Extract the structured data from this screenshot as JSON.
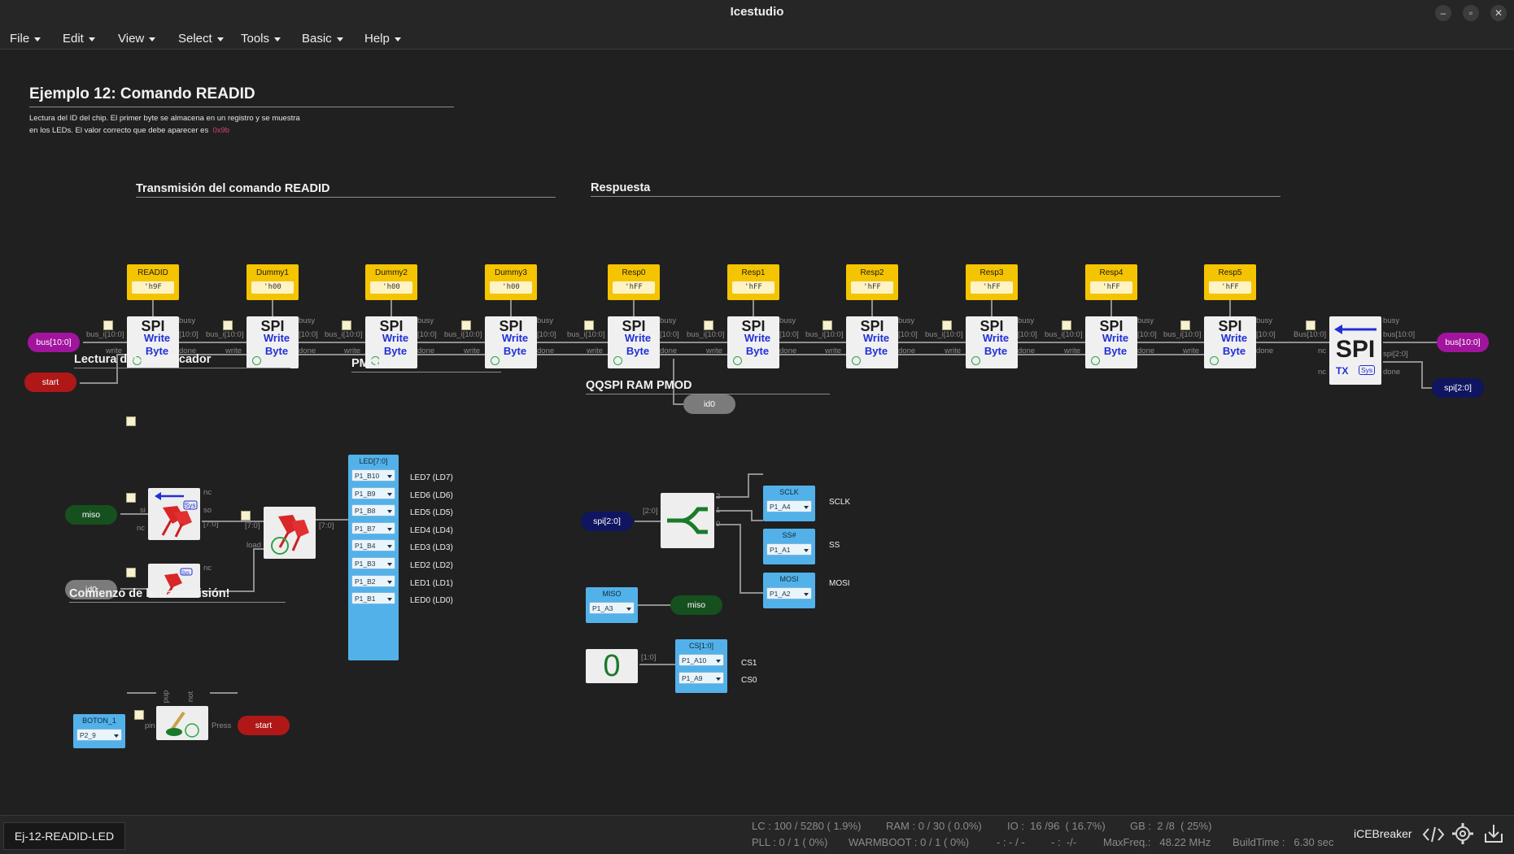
{
  "window": {
    "title": "Icestudio"
  },
  "menu": [
    "File",
    "Edit",
    "View",
    "Select",
    "Tools",
    "Basic",
    "Help"
  ],
  "canvas": {
    "title": "Ejemplo 12: Comando READID",
    "description_1": "Lectura del ID del chip. El primer byte se almacena en un registro y se muestra",
    "description_2": "en los LEDs. El valor correcto que debe aparecer es",
    "description_value": "0x9b",
    "section_tx": "Transmisión del comando READID",
    "section_resp": "Respuesta",
    "section_read": "Lectura del identificador",
    "section_pmod": "PMOD 8LD",
    "section_qqspi": "QQSPI RAM PMOD",
    "section_start": "Comienzo de la transmisión!",
    "constants": [
      {
        "name": "READID",
        "value": "'h9F"
      },
      {
        "name": "Dummy1",
        "value": "'h00"
      },
      {
        "name": "Dummy2",
        "value": "'h00"
      },
      {
        "name": "Dummy3",
        "value": "'h00"
      },
      {
        "name": "Resp0",
        "value": "'hFF"
      },
      {
        "name": "Resp1",
        "value": "'hFF"
      },
      {
        "name": "Resp2",
        "value": "'hFF"
      },
      {
        "name": "Resp3",
        "value": "'hFF"
      },
      {
        "name": "Resp4",
        "value": "'hFF"
      },
      {
        "name": "Resp5",
        "value": "'hFF"
      }
    ],
    "spi_block": {
      "title": "SPI",
      "line1": "Write",
      "line2": "Byte"
    },
    "spi_tx": {
      "title": "SPI",
      "sub": "TX",
      "badge": "Sys"
    },
    "port_labels": {
      "bus_in": "bus_i[10:0]",
      "bus_short": "[10:0]",
      "busy": "busy",
      "write": "write",
      "done": "done",
      "bus_in_tx": "Bus[10:0]",
      "bus_out_tx": "bus[10:0]",
      "nc": "nc",
      "spi_out": "spi[2:0]",
      "si": "si",
      "so": "so",
      "b70": "[7:0]",
      "load": "load",
      "pup": "pup",
      "not": "not",
      "pin": "pin",
      "press": "Press",
      "sel2": "[2:0]",
      "idx2": "2",
      "idx1": "1",
      "idx0": "0",
      "b10": "[1:0]"
    },
    "pills": {
      "bus_left": "bus[10:0]",
      "start": "start",
      "bus_right": "bus[10:0]",
      "spi_right": "spi[2:0]",
      "id0": "id0",
      "miso_left": "miso",
      "id0_left": "id0",
      "spi_left": "spi[2:0]",
      "miso_right": "miso",
      "start_right": "start"
    },
    "led_block": {
      "name": "LED[7:0]",
      "pins": [
        "P1_B10",
        "P1_B9",
        "P1_B8",
        "P1_B7",
        "P1_B4",
        "P1_B3",
        "P1_B2",
        "P1_B1"
      ],
      "labels": [
        "LED7 (LD7)",
        "LED6 (LD6)",
        "LED5 (LD5)",
        "LED4 (LD4)",
        "LED3 (LD3)",
        "LED2 (LD2)",
        "LED1 (LD1)",
        "LED0 (LD0)"
      ]
    },
    "qqspi": {
      "sclk": {
        "name": "SCLK",
        "pin": "P1_A4",
        "label": "SCLK"
      },
      "ss": {
        "name": "SS#",
        "pin": "P1_A1",
        "label": "SS"
      },
      "mosi": {
        "name": "MOSI",
        "pin": "P1_A2",
        "label": "MOSI"
      },
      "miso": {
        "name": "MISO",
        "pin": "P1_A3"
      },
      "cs": {
        "name": "CS[1:0]",
        "pins": [
          "P1_A10",
          "P1_A9"
        ],
        "labels": [
          "CS1",
          "CS0"
        ]
      },
      "const_zero": "0"
    },
    "button": {
      "name": "BOTON_1",
      "pin": "P2_9"
    }
  },
  "status": {
    "project": "Ej-12-READID-LED",
    "lc": "LC : 100 / 5280 ( 1.9%)",
    "ram": "RAM : 0 / 30 ( 0.0%)",
    "io": "IO :  16 /96  ( 16.7%)",
    "gb": "GB :  2 /8  ( 25%)",
    "pll": "PLL : 0 / 1 ( 0%)",
    "warmboot": "WARMBOOT : 0 / 1 ( 0%)",
    "dash1": "- : - / -",
    "dash2": "- :  -/-",
    "maxfreq": "MaxFreq.:   48.22 MHz",
    "buildtime": "BuildTime :   6.30 sec",
    "board": "iCEBreaker"
  }
}
